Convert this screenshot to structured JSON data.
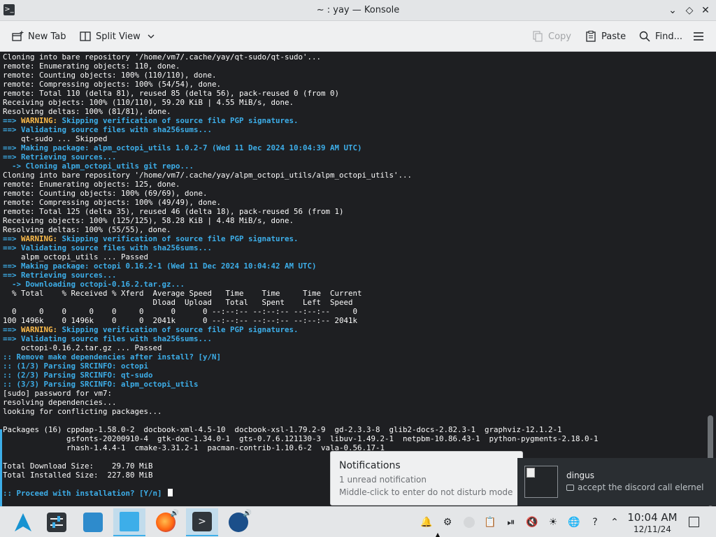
{
  "window": {
    "title": "~ : yay — Konsole"
  },
  "toolbar": {
    "new_tab": "New Tab",
    "split_view": "Split View",
    "copy": "Copy",
    "paste": "Paste",
    "find": "Find..."
  },
  "terminal": {
    "lines": [
      [
        {
          "t": "Cloning into bare repository '/home/vm7/.cache/yay/qt-sudo/qt-sudo'...",
          "c": "w"
        }
      ],
      [
        {
          "t": "remote: Enumerating objects: 110, done.",
          "c": "w"
        }
      ],
      [
        {
          "t": "remote: Counting objects: 100% (110/110), done.",
          "c": "w"
        }
      ],
      [
        {
          "t": "remote: Compressing objects: 100% (54/54), done.",
          "c": "w"
        }
      ],
      [
        {
          "t": "remote: Total 110 (delta 81), reused 85 (delta 56), pack-reused 0 (from 0)",
          "c": "w"
        }
      ],
      [
        {
          "t": "Receiving objects: 100% (110/110), 59.20 KiB | 4.55 MiB/s, done.",
          "c": "w"
        }
      ],
      [
        {
          "t": "Resolving deltas: 100% (81/81), done.",
          "c": "w"
        }
      ],
      [
        {
          "t": "==> ",
          "c": "blu"
        },
        {
          "t": "WARNING:",
          "c": "yel"
        },
        {
          "t": " Skipping verification of source file PGP signatures.",
          "c": "blu"
        }
      ],
      [
        {
          "t": "==> ",
          "c": "blu"
        },
        {
          "t": "Validating source files with sha256sums...",
          "c": "blu"
        }
      ],
      [
        {
          "t": "    qt-sudo ... Skipped",
          "c": "w"
        }
      ],
      [
        {
          "t": "==> ",
          "c": "blu"
        },
        {
          "t": "Making package: alpm_octopi_utils 1.0.2-7 (Wed 11 Dec 2024 10:04:39 AM UTC)",
          "c": "blu"
        }
      ],
      [
        {
          "t": "==> ",
          "c": "blu"
        },
        {
          "t": "Retrieving sources...",
          "c": "blu"
        }
      ],
      [
        {
          "t": "  -> ",
          "c": "blu"
        },
        {
          "t": "Cloning alpm_octopi_utils git repo...",
          "c": "blu"
        }
      ],
      [
        {
          "t": "Cloning into bare repository '/home/vm7/.cache/yay/alpm_octopi_utils/alpm_octopi_utils'...",
          "c": "w"
        }
      ],
      [
        {
          "t": "remote: Enumerating objects: 125, done.",
          "c": "w"
        }
      ],
      [
        {
          "t": "remote: Counting objects: 100% (69/69), done.",
          "c": "w"
        }
      ],
      [
        {
          "t": "remote: Compressing objects: 100% (49/49), done.",
          "c": "w"
        }
      ],
      [
        {
          "t": "remote: Total 125 (delta 35), reused 46 (delta 18), pack-reused 56 (from 1)",
          "c": "w"
        }
      ],
      [
        {
          "t": "Receiving objects: 100% (125/125), 58.28 KiB | 4.48 MiB/s, done.",
          "c": "w"
        }
      ],
      [
        {
          "t": "Resolving deltas: 100% (55/55), done.",
          "c": "w"
        }
      ],
      [
        {
          "t": "==> ",
          "c": "blu"
        },
        {
          "t": "WARNING:",
          "c": "yel"
        },
        {
          "t": " Skipping verification of source file PGP signatures.",
          "c": "blu"
        }
      ],
      [
        {
          "t": "==> ",
          "c": "blu"
        },
        {
          "t": "Validating source files with sha256sums...",
          "c": "blu"
        }
      ],
      [
        {
          "t": "    alpm_octopi_utils ... Passed",
          "c": "w"
        }
      ],
      [
        {
          "t": "==> ",
          "c": "blu"
        },
        {
          "t": "Making package: octopi 0.16.2-1 (Wed 11 Dec 2024 10:04:42 AM UTC)",
          "c": "blu"
        }
      ],
      [
        {
          "t": "==> ",
          "c": "blu"
        },
        {
          "t": "Retrieving sources...",
          "c": "blu"
        }
      ],
      [
        {
          "t": "  -> ",
          "c": "blu"
        },
        {
          "t": "Downloading octopi-0.16.2.tar.gz...",
          "c": "blu"
        }
      ],
      [
        {
          "t": "  % Total    % Received % Xferd  Average Speed   Time    Time     Time  Current",
          "c": "w"
        }
      ],
      [
        {
          "t": "                                 Dload  Upload   Total   Spent    Left  Speed",
          "c": "w"
        }
      ],
      [
        {
          "t": "  0     0    0     0    0     0      0      0 --:--:-- --:--:-- --:--:--     0",
          "c": "w"
        }
      ],
      [
        {
          "t": "100 1496k    0 1496k    0     0  2041k      0 --:--:-- --:--:-- --:--:-- 2041k",
          "c": "w"
        }
      ],
      [
        {
          "t": "==> ",
          "c": "blu"
        },
        {
          "t": "WARNING:",
          "c": "yel"
        },
        {
          "t": " Skipping verification of source file PGP signatures.",
          "c": "blu"
        }
      ],
      [
        {
          "t": "==> ",
          "c": "blu"
        },
        {
          "t": "Validating source files with sha256sums...",
          "c": "blu"
        }
      ],
      [
        {
          "t": "    octopi-0.16.2.tar.gz ... Passed",
          "c": "w"
        }
      ],
      [
        {
          "t": ":: Remove make dependencies after install? [y/N]",
          "c": "blu"
        }
      ],
      [
        {
          "t": ":: (1/3) Parsing SRCINFO: octopi",
          "c": "blu"
        }
      ],
      [
        {
          "t": ":: (2/3) Parsing SRCINFO: qt-sudo",
          "c": "blu"
        }
      ],
      [
        {
          "t": ":: (3/3) Parsing SRCINFO: alpm_octopi_utils",
          "c": "blu"
        }
      ],
      [
        {
          "t": "[sudo] password for vm7:",
          "c": "w"
        }
      ],
      [
        {
          "t": "resolving dependencies...",
          "c": "w"
        }
      ],
      [
        {
          "t": "looking for conflicting packages...",
          "c": "w"
        }
      ],
      [
        {
          "t": "",
          "c": "w"
        }
      ],
      [
        {
          "t": "Packages (16) cppdap-1.58.0-2  docbook-xml-4.5-10  docbook-xsl-1.79.2-9  gd-2.3.3-8  glib2-docs-2.82.3-1  graphviz-12.1.2-1",
          "c": "w"
        }
      ],
      [
        {
          "t": "              gsfonts-20200910-4  gtk-doc-1.34.0-1  gts-0.7.6.121130-3  libuv-1.49.2-1  netpbm-10.86.43-1  python-pygments-2.18.0-1",
          "c": "w"
        }
      ],
      [
        {
          "t": "              rhash-1.4.4-1  cmake-3.31.2-1  pacman-contrib-1.10.6-2  vala-0.56.17-1",
          "c": "w"
        }
      ],
      [
        {
          "t": "",
          "c": "w"
        }
      ],
      [
        {
          "t": "Total Download Size:    29.70 MiB",
          "c": "w"
        }
      ],
      [
        {
          "t": "Total Installed Size:  227.80 MiB",
          "c": "w"
        }
      ],
      [
        {
          "t": "",
          "c": "w"
        }
      ],
      [
        {
          "t": ":: Proceed with installation? [Y/n] ",
          "c": "blu"
        }
      ]
    ]
  },
  "notifications": {
    "title": "Notifications",
    "unread": "1 unread notification",
    "hint": "Middle-click to enter do not disturb mode"
  },
  "toast": {
    "sender": "dingus",
    "message": "accept the discord call elernel"
  },
  "clock": {
    "time": "10:04 AM",
    "date": "12/11/24"
  },
  "colors": {
    "accent": "#3daee9",
    "warning": "#fdbc4b",
    "terminal_bg": "#1e1f22"
  }
}
